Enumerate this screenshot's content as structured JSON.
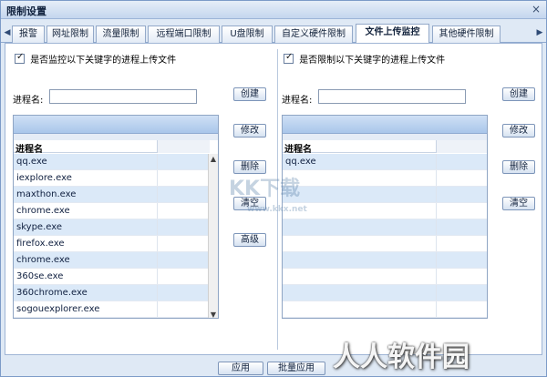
{
  "window": {
    "title": "限制设置",
    "close_glyph": "×"
  },
  "tabs": [
    {
      "label": "报警"
    },
    {
      "label": "网址限制"
    },
    {
      "label": "流量限制"
    },
    {
      "label": "远程端口限制"
    },
    {
      "label": "U盘限制"
    },
    {
      "label": "自定义硬件限制"
    },
    {
      "label": "文件上传监控",
      "active": true
    },
    {
      "label": "其他硬件限制"
    }
  ],
  "left_panel": {
    "checkbox_label": "是否监控以下关键字的进程上传文件",
    "checkbox_checked": true,
    "field_label": "进程名:",
    "field_value": "",
    "column_header": "进程名",
    "rows": [
      "qq.exe",
      "iexplore.exe",
      "maxthon.exe",
      "chrome.exe",
      "skype.exe",
      "firefox.exe",
      "chrome.exe",
      "360se.exe",
      "360chrome.exe",
      "sogouexplorer.exe"
    ],
    "buttons": {
      "create": "创建",
      "modify": "修改",
      "delete": "删除",
      "clear": "清空",
      "advanced": "高级"
    }
  },
  "right_panel": {
    "checkbox_label": "是否限制以下关键字的进程上传文件",
    "checkbox_checked": true,
    "field_label": "进程名:",
    "field_value": "",
    "column_header": "进程名",
    "rows": [
      "qq.exe",
      "",
      "",
      "",
      "",
      "",
      "",
      "",
      "",
      ""
    ],
    "buttons": {
      "create": "创建",
      "modify": "修改",
      "delete": "删除",
      "clear": "清空"
    }
  },
  "footer": {
    "apply": "应用",
    "batch_apply": "批量应用"
  },
  "watermarks": {
    "center": "KK下载",
    "url": "www.kkx.net",
    "brand": "人人软件园"
  }
}
